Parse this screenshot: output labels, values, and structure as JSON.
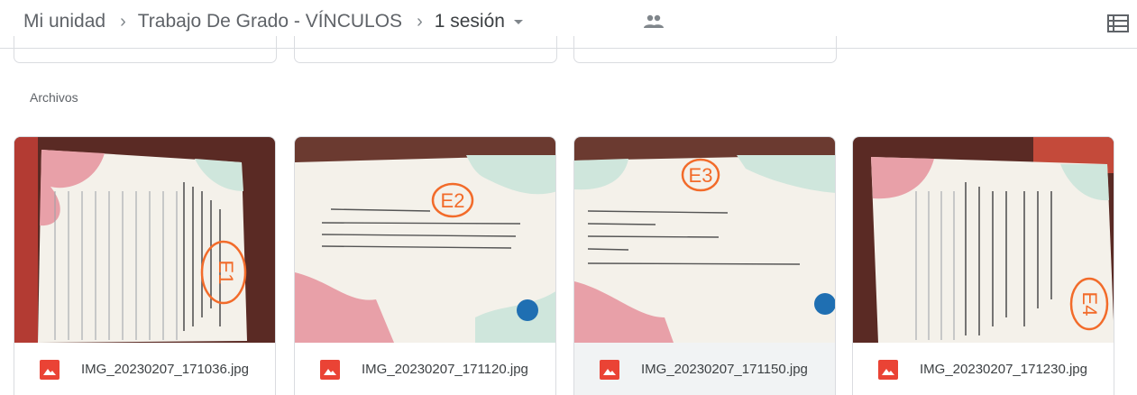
{
  "breadcrumb": {
    "items": [
      "Mi unidad",
      "Trabajo De Grado - VÍNCULOS",
      "1 sesión"
    ]
  },
  "icons": {
    "separator": "chevron-right-icon",
    "dropdown": "caret-down-icon",
    "shared": "people-icon",
    "view": "list-view-icon",
    "file_type": "image-file-icon"
  },
  "section": {
    "title": "Archivos"
  },
  "files": [
    {
      "name": "IMG_20230207_171036.jpg",
      "label": "E1"
    },
    {
      "name": "IMG_20230207_171120.jpg",
      "label": "E2"
    },
    {
      "name": "IMG_20230207_171150.jpg",
      "label": "E3"
    },
    {
      "name": "IMG_20230207_171230.jpg",
      "label": "E4"
    }
  ],
  "colors": {
    "accent_red": "#ea4335",
    "desk_brown": "#5a2a24",
    "ink_orange": "#f26b2a",
    "paper": "#f4f1ea"
  }
}
